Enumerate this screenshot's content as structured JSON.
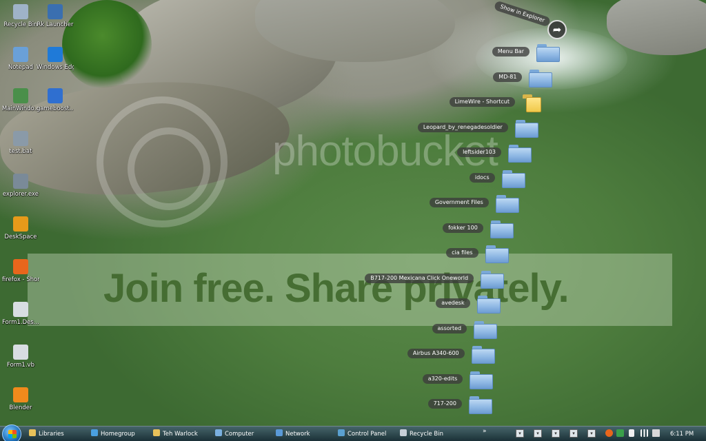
{
  "desktop_icons": [
    {
      "label": "Recycle Bin",
      "icon": "recycle-bin-icon",
      "color": "#9fb3c8"
    },
    {
      "label": "Rk Launcher",
      "icon": "rk-launcher-icon",
      "color": "#3a6fb0"
    },
    {
      "label": "Notepad",
      "icon": "notepad-icon",
      "color": "#6aa0d8"
    },
    {
      "label": "Windows Edge",
      "icon": "edge-icon",
      "color": "#1f7ad8"
    },
    {
      "label": "MainWindo...",
      "icon": "app-icon",
      "color": "#4a8f4a"
    },
    {
      "label": "gameboost...",
      "icon": "gameboost-icon",
      "color": "#2f6fd0"
    },
    {
      "label": "test.bat",
      "icon": "batch-file-icon",
      "color": "#8a9aa8"
    },
    {
      "label": "explorer.exe",
      "icon": "exe-icon",
      "color": "#7a8a98"
    },
    {
      "label": "DeskSpace",
      "icon": "deskspace-icon",
      "color": "#e69a1a"
    },
    {
      "label": "firefox - Shortcut",
      "icon": "firefox-icon",
      "color": "#e8661c"
    },
    {
      "label": "Form1.Des...",
      "icon": "file-icon",
      "color": "#d8dde2"
    },
    {
      "label": "Form1.vb",
      "icon": "vb-file-icon",
      "color": "#d8dde2"
    },
    {
      "label": "Blender",
      "icon": "blender-icon",
      "color": "#f08a1c"
    }
  ],
  "stack": {
    "explorer_label": "Show in Explorer",
    "items": [
      {
        "label": "Menu Bar",
        "type": "folder"
      },
      {
        "label": "MD-81",
        "type": "folder"
      },
      {
        "label": "LimeWire - Shortcut",
        "type": "shortcut"
      },
      {
        "label": "Leopard_by_renegadesoldier",
        "type": "folder"
      },
      {
        "label": "leftsider103",
        "type": "folder"
      },
      {
        "label": "idocs",
        "type": "folder"
      },
      {
        "label": "Government Files",
        "type": "folder"
      },
      {
        "label": "fokker 100",
        "type": "folder"
      },
      {
        "label": "cia files",
        "type": "folder"
      },
      {
        "label": "B717-200 Mexicana Click Oneworld",
        "type": "folder"
      },
      {
        "label": "avedesk",
        "type": "folder"
      },
      {
        "label": "assorted",
        "type": "folder"
      },
      {
        "label": "Airbus A340-600",
        "type": "folder"
      },
      {
        "label": "a320-edits",
        "type": "folder"
      },
      {
        "label": "717-200",
        "type": "folder"
      }
    ]
  },
  "watermark": {
    "brand": "photobucket",
    "tagline": "Join free. Share privately."
  },
  "taskbar": {
    "buttons": [
      {
        "label": "Libraries",
        "icon": "libraries-icon",
        "color": "#e8c25a"
      },
      {
        "label": "Homegroup",
        "icon": "homegroup-icon",
        "color": "#4aa0e0"
      },
      {
        "label": "Teh Warlock",
        "icon": "user-folder-icon",
        "color": "#e8c25a"
      },
      {
        "label": "Computer",
        "icon": "computer-icon",
        "color": "#7ab0e0"
      },
      {
        "label": "Network",
        "icon": "network-icon",
        "color": "#5a9ad8"
      },
      {
        "label": "Control Panel",
        "icon": "control-panel-icon",
        "color": "#5aa0d0"
      },
      {
        "label": "Recycle Bin",
        "icon": "recycle-bin-icon",
        "color": "#c8d0d8"
      }
    ],
    "more": "»",
    "clock": "6:11 PM"
  }
}
